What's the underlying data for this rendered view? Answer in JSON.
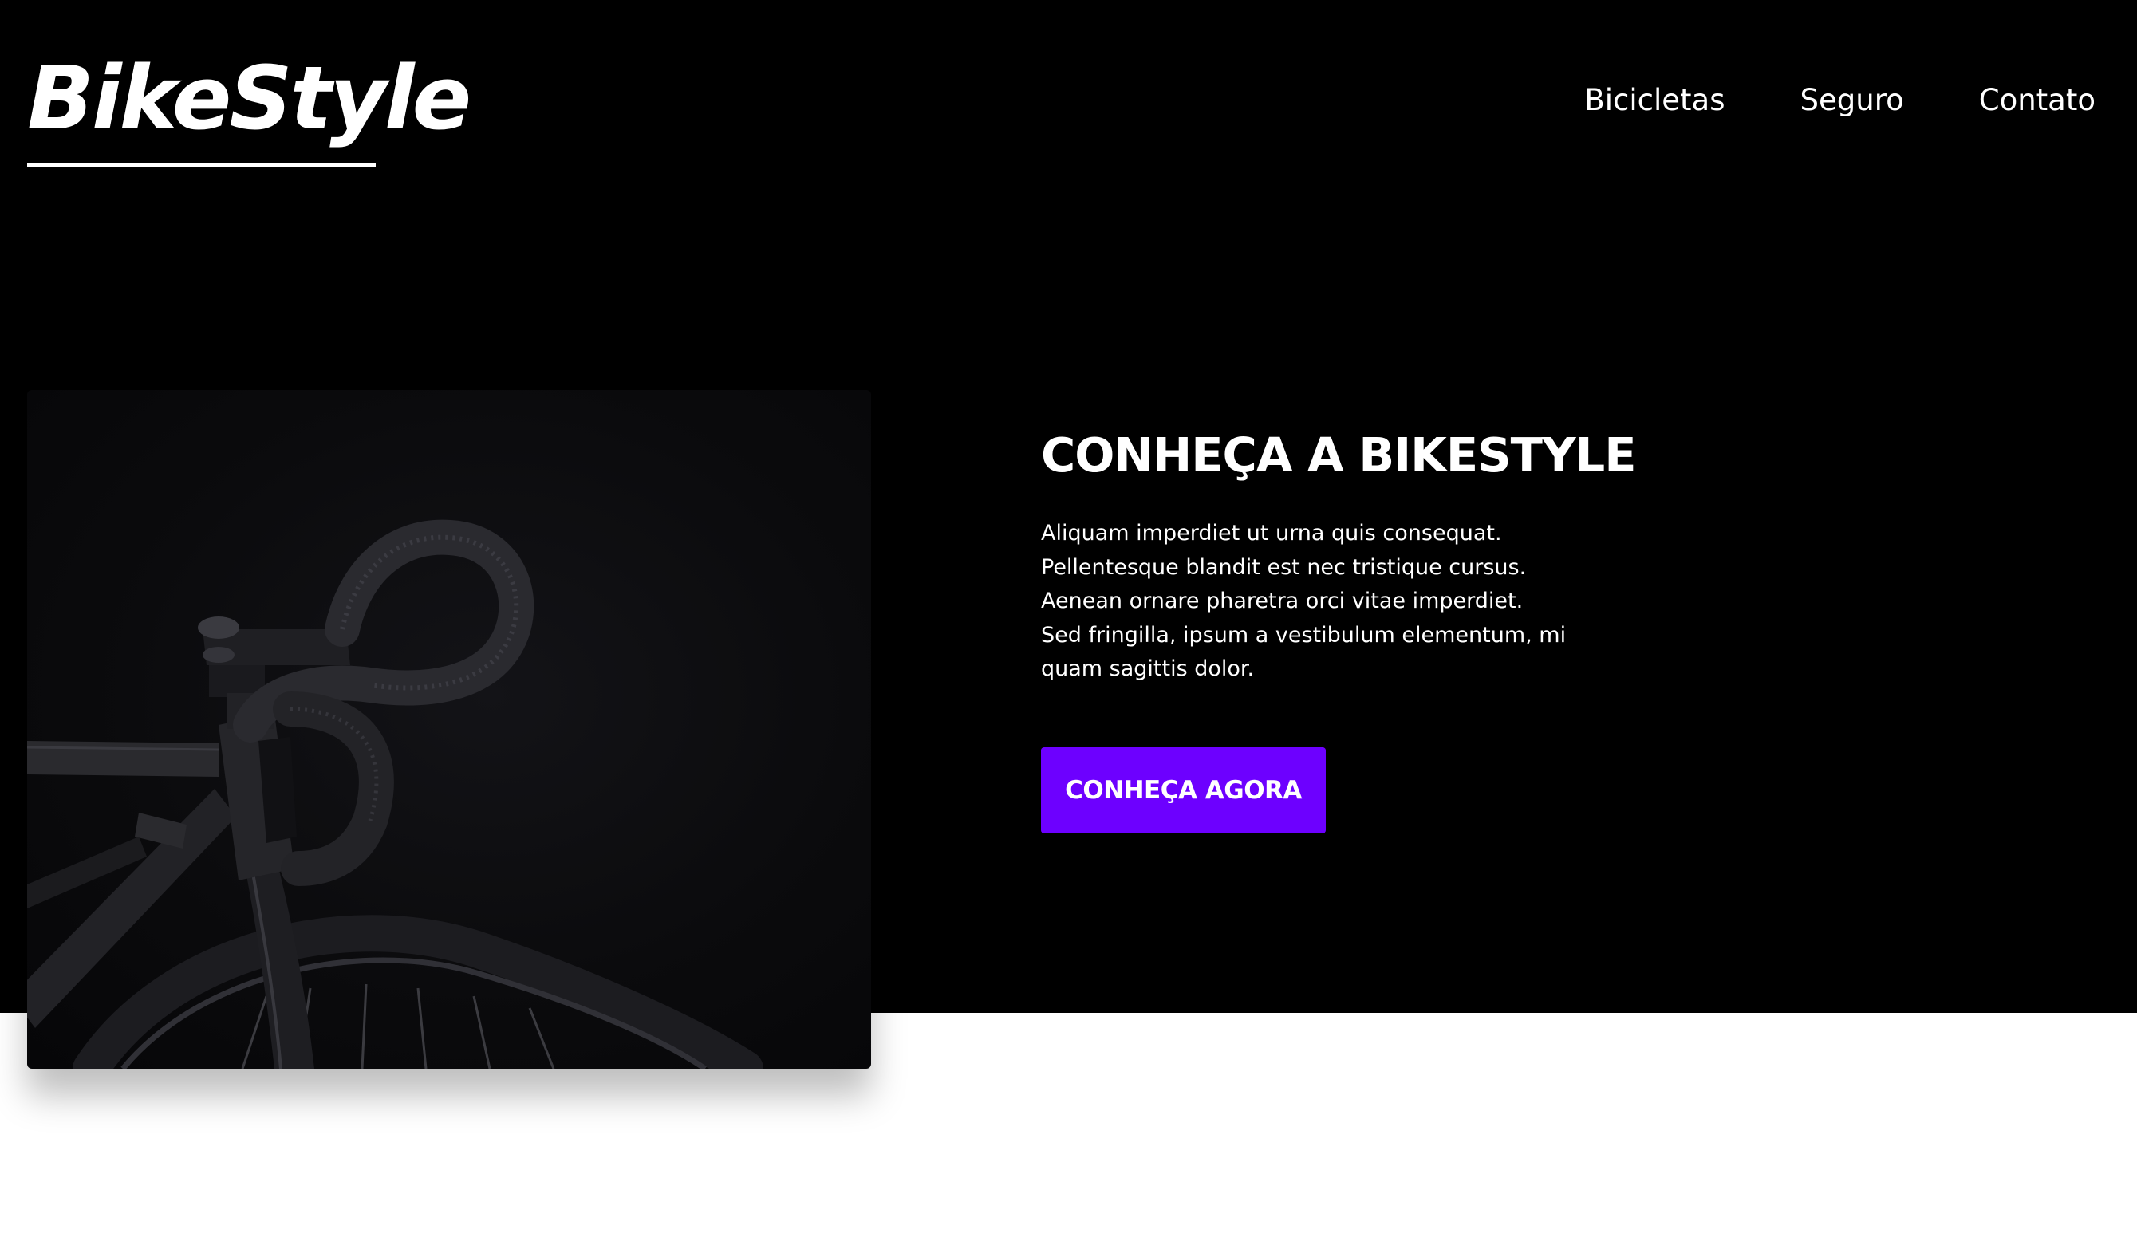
{
  "brand": {
    "logo_text": "BikeStyle"
  },
  "nav": {
    "items": [
      {
        "label": "Bicicletas"
      },
      {
        "label": "Seguro"
      },
      {
        "label": "Contato"
      }
    ]
  },
  "hero": {
    "title": "CONHEÇA A BIKESTYLE",
    "description": "Aliquam imperdiet ut urna quis consequat. Pellentesque blandit est nec tristique cursus. Aenean ornare pharetra orci vitae imperdiet. Sed fringilla, ipsum a vestibulum elementum, mi quam sagittis dolor.",
    "cta_label": "CONHEÇA AGORA"
  },
  "colors": {
    "hero_background": "#000000",
    "page_background": "#ffffff",
    "accent": "#6d00ff",
    "text_on_dark": "#ffffff"
  }
}
